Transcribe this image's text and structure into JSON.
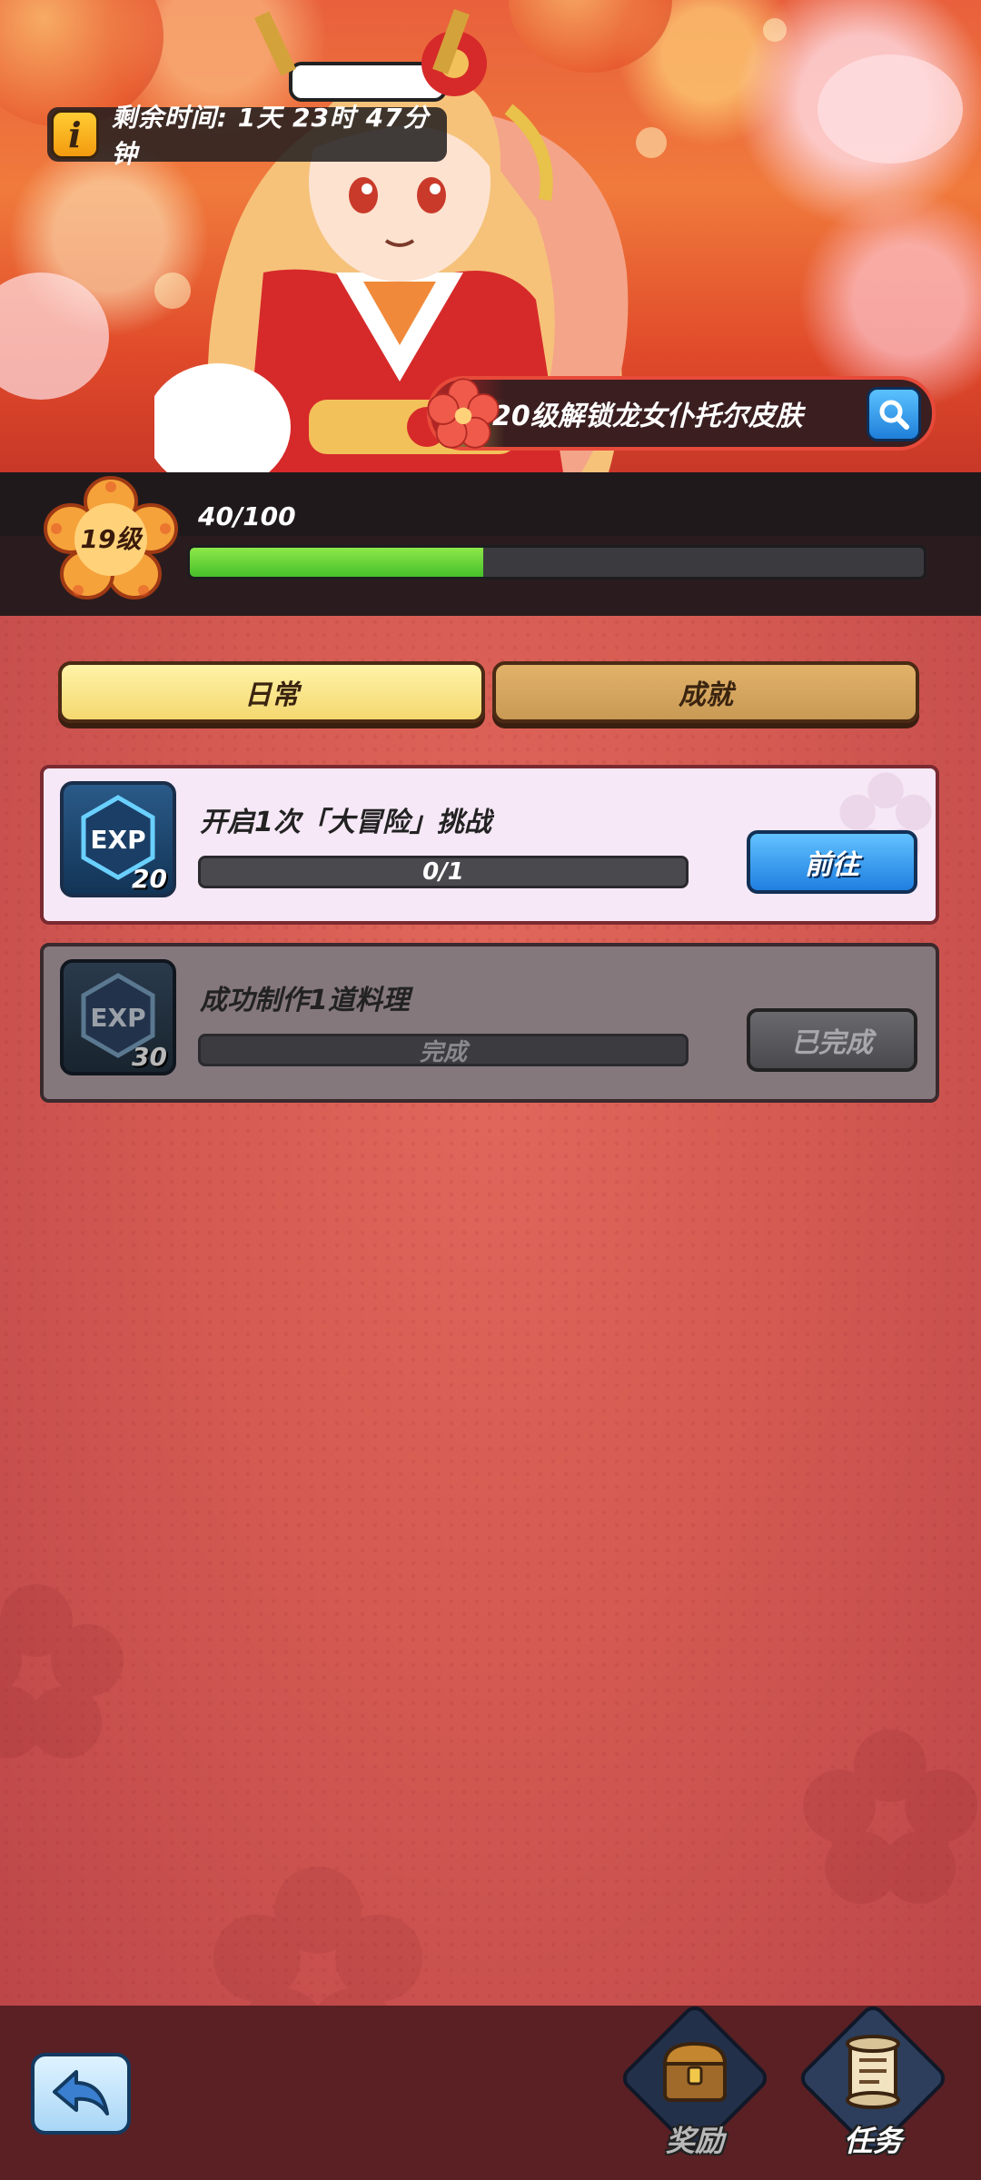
{
  "banner": {
    "timer": {
      "info_icon": "info-icon",
      "text": "剩余时间: 1天 23时 47分钟"
    },
    "unlock": {
      "text": "20级解锁龙女仆托尔皮肤",
      "search_icon": "search-icon"
    }
  },
  "level": {
    "badge_text": "19级",
    "xp_text": "40/100",
    "xp_fraction": 0.4
  },
  "tabs": [
    {
      "label": "日常",
      "active": true
    },
    {
      "label": "成就",
      "active": false
    }
  ],
  "tasks": [
    {
      "exp_label": "EXP",
      "exp_value": "20",
      "title": "开启1次「大冒险」挑战",
      "progress_text": "0/1",
      "button_label": "前往",
      "state": "active"
    },
    {
      "exp_label": "EXP",
      "exp_value": "30",
      "title": "成功制作1道料理",
      "progress_text": "完成",
      "button_label": "已完成",
      "state": "completed"
    }
  ],
  "bottom_nav": {
    "back_icon": "back-arrow-icon",
    "items": [
      {
        "label": "奖励",
        "icon": "treasure-chest-icon"
      },
      {
        "label": "任务",
        "icon": "scroll-icon"
      }
    ]
  },
  "colors": {
    "accent_blue": "#1f7fe0",
    "xp_green": "#46c02a",
    "main_background": "#d45a52"
  }
}
